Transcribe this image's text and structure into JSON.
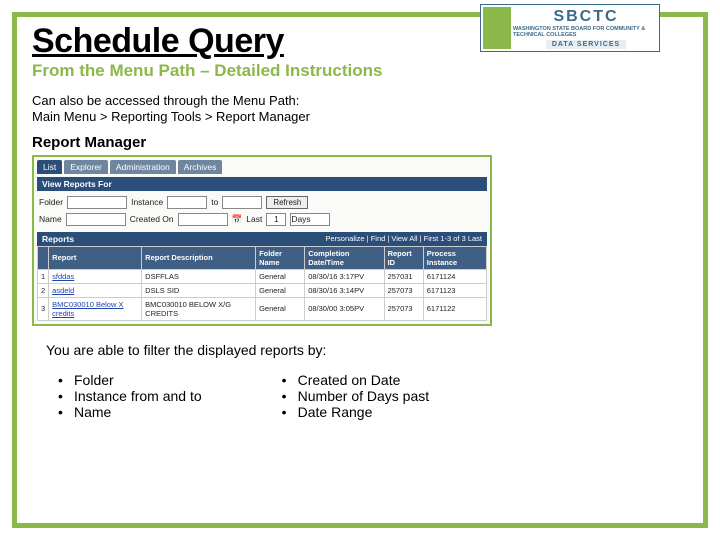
{
  "logo": {
    "acronym": "SBCTC",
    "tagline": "WASHINGTON STATE BOARD FOR COMMUNITY & TECHNICAL COLLEGES",
    "sublabel": "DATA SERVICES"
  },
  "title": "Schedule Query",
  "subtitle": "From the Menu Path – Detailed Instructions",
  "intro_line1": "Can also be accessed through the  Menu Path:",
  "intro_line2": "Main Menu > Reporting Tools > Report Manager",
  "section_label": "Report Manager",
  "rm": {
    "tabs": [
      "List",
      "Explorer",
      "Administration",
      "Archives"
    ],
    "view_title": "View Reports For",
    "labels": {
      "folder": "Folder",
      "instance": "Instance",
      "to": "to",
      "refresh": "Refresh",
      "name": "Name",
      "created_on": "Created On",
      "last": "Last",
      "days": "Days"
    },
    "values": {
      "last_n": "1"
    },
    "reports_title": "Reports",
    "pager": "Personalize | Find | View All | First 1-3 of 3 Last",
    "columns": [
      "",
      "Report",
      "Report Description",
      "Folder Name",
      "Completion Date/Time",
      "Report ID",
      "Process Instance"
    ],
    "rows": [
      {
        "n": "1",
        "report": "sfddas",
        "desc": "DSFFLAS",
        "folder": "General",
        "dt": "08/30/16 3:17PV",
        "rid": "257031",
        "pi": "6171124"
      },
      {
        "n": "2",
        "report": "asdeld",
        "desc": "DSLS SID",
        "folder": "General",
        "dt": "08/30/16 3:14PV",
        "rid": "257073",
        "pi": "6171123"
      },
      {
        "n": "3",
        "report": "BMC030010 Below X credits",
        "desc": "BMC030010 BELOW X/G CREDITS",
        "folder": "General",
        "dt": "08/30/00 3:05PV",
        "rid": "257073",
        "pi": "6171122"
      }
    ]
  },
  "filter_statement": "You are able to filter the displayed reports by:",
  "left_list": [
    "Folder",
    "Instance from and to",
    "Name"
  ],
  "right_list": [
    "Created on Date",
    "Number of Days past",
    "Date Range"
  ]
}
